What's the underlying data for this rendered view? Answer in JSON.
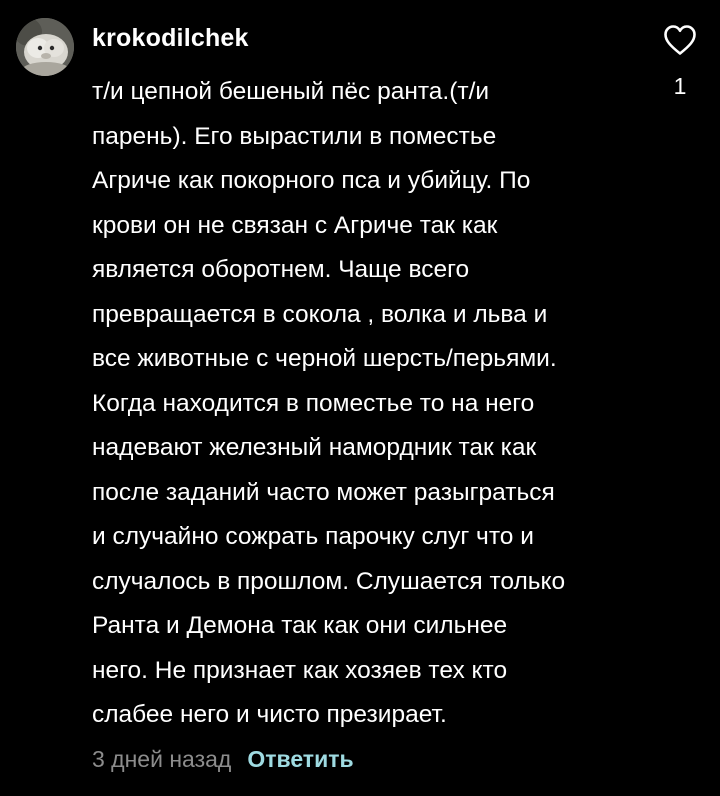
{
  "comment": {
    "username": "krokodilchek",
    "lines": [
      "т/и цепной бешеный пёс ранта.(т/и",
      "парень). Его вырастили в поместье",
      "Агриче как покорного пса и убийцу. По",
      "крови он не связан с Агриче так как",
      "является оборотнем. Чаще всего",
      "превращается в сокола , волка и льва и",
      "все животные с черной шерсть/перьями.",
      "Когда находится в поместье то на него",
      "надевают железный намордник так как",
      "после заданий часто может разыграться",
      "и случайно сожрать парочку слуг что и",
      "случалось в прошлом. Слушается только",
      "Ранта и Демона так как они сильнее",
      "него. Не признает как хозяев тех кто",
      "слабее него и чисто презирает."
    ],
    "timestamp": "3 дней назад",
    "reply_label": "Ответить",
    "like_count": "1"
  },
  "icons": {
    "like": "heart-outline-icon",
    "avatar": "avatar-image"
  },
  "colors": {
    "background": "#000000",
    "text": "#ffffff",
    "timestamp": "#8c8c8c",
    "reply": "#9fdbe2"
  }
}
